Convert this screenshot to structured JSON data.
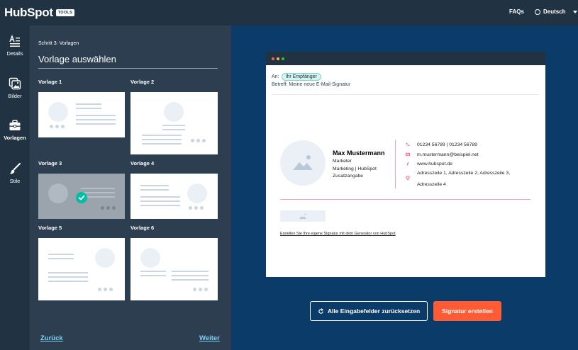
{
  "header": {
    "logo_text": "HubSpot",
    "logo_badge": "TOOLS",
    "faq_label": "FAQs",
    "language": "Deutsch"
  },
  "rail": {
    "items": [
      {
        "label": "Details",
        "icon": "text-lines-icon"
      },
      {
        "label": "Bilder",
        "icon": "images-icon"
      },
      {
        "label": "Vorlagen",
        "icon": "briefcase-icon"
      },
      {
        "label": "Stile",
        "icon": "brush-icon"
      }
    ],
    "active": "Vorlagen"
  },
  "panel": {
    "step": "Schritt 3: Vorlagen",
    "title": "Vorlage auswählen",
    "templates": [
      {
        "label": "Vorlage 1"
      },
      {
        "label": "Vorlage 2"
      },
      {
        "label": "Vorlage 3"
      },
      {
        "label": "Vorlage 4"
      },
      {
        "label": "Vorlage 5"
      },
      {
        "label": "Vorlage 6"
      }
    ],
    "selected_template": "Vorlage 3",
    "back_label": "Zurück",
    "next_label": "Weiter"
  },
  "preview": {
    "to_label": "An:",
    "recipient": "Ihr Empfänger",
    "subject": "Betreff: Meine neue E-Mail-Signatur",
    "name": "Max Mustermann",
    "job_title": "Marketer",
    "department": "Marketing | HubSpot",
    "extra": "Zusatzangabe",
    "phone": "01234 56789 | 01234 56789",
    "email": "m.mustermann@beispiel.net",
    "website": "www.hubspot.de",
    "address_line1": "Adresszeile 1, Adresszeile 2, Adresszeile 3,",
    "address_line2": "Adresszeile 4",
    "generator_link": "Erstellen Sie Ihre eigene Signatur mit dem Generator von HubSpot",
    "accent_color": "#f2547d"
  },
  "actions": {
    "reset_label": "Alle Eingabefelder zurücksetzen",
    "create_label": "Signatur erstellen"
  }
}
